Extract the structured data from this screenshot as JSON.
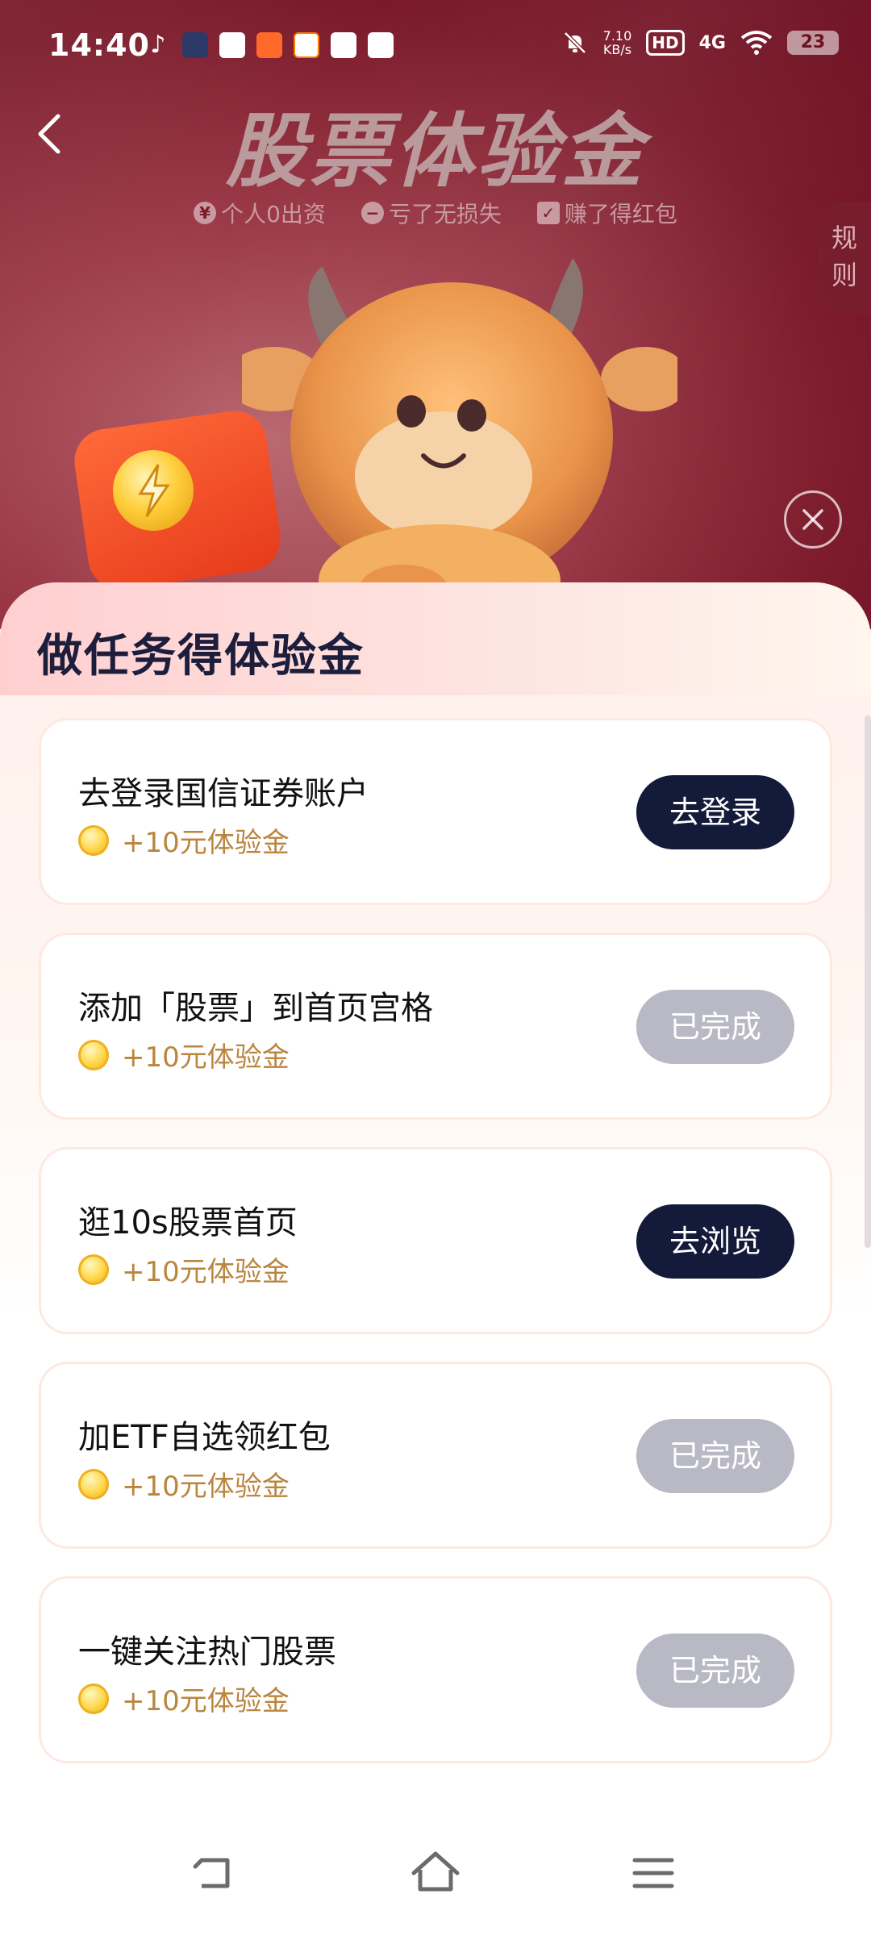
{
  "status_bar": {
    "time": "14:40",
    "speed_value": "7.10",
    "speed_unit": "KB/s",
    "hd": "HD",
    "network": "4G",
    "battery": "23",
    "notification_icons": [
      "music-note-icon",
      "app-icon-1",
      "video-app-icon",
      "app-icon-3",
      "app-58-icon",
      "app-icon-5",
      "app-icon-6"
    ]
  },
  "header": {
    "title": "股票体验金",
    "features": [
      {
        "icon": "yen-icon",
        "label": "个人0出资"
      },
      {
        "icon": "minus-icon",
        "label": "亏了无损失"
      },
      {
        "icon": "red-packet-icon",
        "label": "赚了得红包"
      }
    ],
    "rules_tab": [
      "规",
      "则"
    ]
  },
  "panel": {
    "title": "做任务得体验金",
    "tasks": [
      {
        "name": "去登录国信证券账户",
        "reward": "+10元体验金",
        "button": "去登录",
        "state": "go"
      },
      {
        "name": "添加「股票」到首页宫格",
        "reward": "+10元体验金",
        "button": "已完成",
        "state": "done"
      },
      {
        "name": "逛10s股票首页",
        "reward": "+10元体验金",
        "button": "去浏览",
        "state": "go"
      },
      {
        "name": "加ETF自选领红包",
        "reward": "+10元体验金",
        "button": "已完成",
        "state": "done"
      },
      {
        "name": "一键关注热门股票",
        "reward": "+10元体验金",
        "button": "已完成",
        "state": "done"
      }
    ]
  },
  "nav_bar": {
    "icons": [
      "back-nav-icon",
      "home-nav-icon",
      "menu-nav-icon"
    ]
  },
  "colors": {
    "hero_dark": "#6e1122",
    "button_go": "#141a3a",
    "button_done": "#b8b9c4",
    "reward_text": "#b9853f",
    "title_text": "#1d1e3c"
  }
}
